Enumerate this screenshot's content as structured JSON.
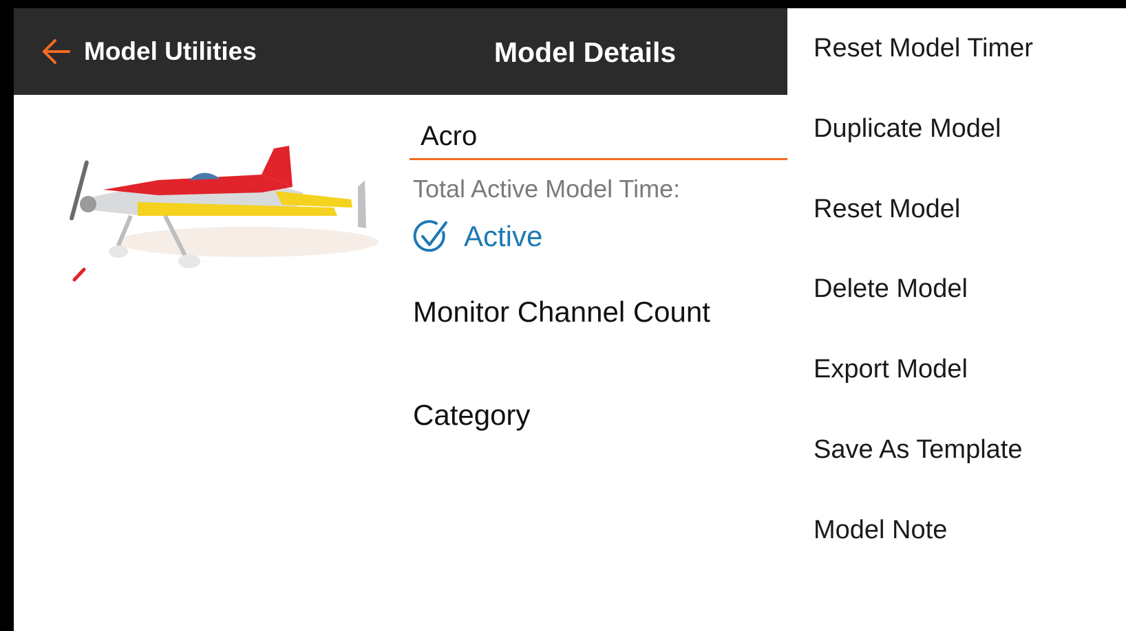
{
  "header": {
    "back_label": "Model Utilities",
    "title": "Model Details"
  },
  "model": {
    "name": "Acro",
    "time_label": "Total Active Model Time:",
    "status_label": "Active",
    "monitor_label": "Monitor Channel Count",
    "category_label": "Category"
  },
  "menu": {
    "items": [
      {
        "label": "Reset Model Timer"
      },
      {
        "label": "Duplicate Model"
      },
      {
        "label": "Reset Model"
      },
      {
        "label": "Delete Model"
      },
      {
        "label": "Export Model"
      },
      {
        "label": "Save As Template"
      },
      {
        "label": "Model Note"
      }
    ]
  },
  "colors": {
    "header_bg": "#2b2b2b",
    "accent_orange": "#f26b21",
    "active_blue": "#1c79b3"
  },
  "icons": {
    "back": "arrow-left-icon",
    "status": "check-circle-icon"
  }
}
